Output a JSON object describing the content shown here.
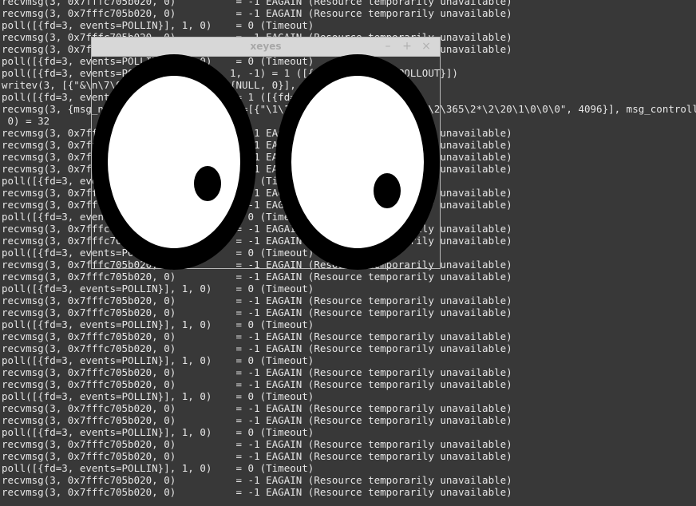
{
  "terminal": {
    "lines": [
      "recvmsg(3, 0x7fffc705b020, 0)          = -1 EAGAIN (Resource temporarily unavailable)",
      "recvmsg(3, 0x7fffc705b020, 0)          = -1 EAGAIN (Resource temporarily unavailable)",
      "poll([{fd=3, events=POLLIN}], 1, 0)    = 0 (Timeout)",
      "recvmsg(3, 0x7fffc705b020, 0)          = -1 EAGAIN (Resource temporarily unavailable)",
      "recvmsg(3, 0x7fffc705b020, 0)          = -1 EAGAIN (Resource temporarily unavailable)",
      "poll([{fd=3, events=POLLIN}], 1, 0)    = 0 (Timeout)",
      "poll([{fd=3, events=POLLIN|POLLOUT}], 1, -1) = 1 ([{fd=3, revents=POLLOUT}])",
      "writev(3, [{\"&\\n\\7\\0\", 4}, {NULL, 0}, {NULL, 0}], 3) = 4",
      "poll([{fd=3, events=POLLIN}], 1, -1)   = 1 ([{fd=3, revents=POLLIN}])",
      "recvmsg(3, {msg_name(0)=NULL, msg_iov(1)=[{\"\\1\\1\\0\\0\\0\\0\\0\\0\\0\\0h\\3\\341\\2\\365\\2*\\2\\20\\1\\0\\0\\0\", 4096}], msg_controllen=0, msg_flags=0}, 0) = 32",
      " 0) = 32",
      "recvmsg(3, 0x7fffc705b020, 0)          = -1 EAGAIN (Resource temporarily unavailable)",
      "recvmsg(3, 0x7fffc705b020, 0)          = -1 EAGAIN (Resource temporarily unavailable)",
      "recvmsg(3, 0x7fffc705b020, 0)          = -1 EAGAIN (Resource temporarily unavailable)",
      "recvmsg(3, 0x7fffc705b020, 0)          = -1 EAGAIN (Resource temporarily unavailable)",
      "poll([{fd=3, events=POLLIN}], 1, 0)    = 0 (Timeout)",
      "recvmsg(3, 0x7fffc705b020, 0)          = -1 EAGAIN (Resource temporarily unavailable)",
      "recvmsg(3, 0x7fffc705b020, 0)          = -1 EAGAIN (Resource temporarily unavailable)",
      "poll([{fd=3, events=POLLIN}], 1, 0)    = 0 (Timeout)",
      "recvmsg(3, 0x7fffc705b020, 0)          = -1 EAGAIN (Resource temporarily unavailable)",
      "recvmsg(3, 0x7fffc705b020, 0)          = -1 EAGAIN (Resource temporarily unavailable)",
      "poll([{fd=3, events=POLLIN}], 1, 0)    = 0 (Timeout)",
      "recvmsg(3, 0x7fffc705b020, 0)          = -1 EAGAIN (Resource temporarily unavailable)",
      "recvmsg(3, 0x7fffc705b020, 0)          = -1 EAGAIN (Resource temporarily unavailable)",
      "poll([{fd=3, events=POLLIN}], 1, 0)    = 0 (Timeout)",
      "recvmsg(3, 0x7fffc705b020, 0)          = -1 EAGAIN (Resource temporarily unavailable)",
      "recvmsg(3, 0x7fffc705b020, 0)          = -1 EAGAIN (Resource temporarily unavailable)",
      "poll([{fd=3, events=POLLIN}], 1, 0)    = 0 (Timeout)",
      "recvmsg(3, 0x7fffc705b020, 0)          = -1 EAGAIN (Resource temporarily unavailable)",
      "recvmsg(3, 0x7fffc705b020, 0)          = -1 EAGAIN (Resource temporarily unavailable)",
      "poll([{fd=3, events=POLLIN}], 1, 0)    = 0 (Timeout)",
      "recvmsg(3, 0x7fffc705b020, 0)          = -1 EAGAIN (Resource temporarily unavailable)",
      "recvmsg(3, 0x7fffc705b020, 0)          = -1 EAGAIN (Resource temporarily unavailable)",
      "poll([{fd=3, events=POLLIN}], 1, 0)    = 0 (Timeout)",
      "recvmsg(3, 0x7fffc705b020, 0)          = -1 EAGAIN (Resource temporarily unavailable)",
      "recvmsg(3, 0x7fffc705b020, 0)          = -1 EAGAIN (Resource temporarily unavailable)",
      "poll([{fd=3, events=POLLIN}], 1, 0)    = 0 (Timeout)",
      "recvmsg(3, 0x7fffc705b020, 0)          = -1 EAGAIN (Resource temporarily unavailable)",
      "recvmsg(3, 0x7fffc705b020, 0)          = -1 EAGAIN (Resource temporarily unavailable)",
      "poll([{fd=3, events=POLLIN}], 1, 0)    = 0 (Timeout)",
      "recvmsg(3, 0x7fffc705b020, 0)          = -1 EAGAIN (Resource temporarily unavailable)",
      "recvmsg(3, 0x7fffc705b020, 0)          = -1 EAGAIN (Resource temporarily unavailable)"
    ]
  },
  "window": {
    "title": "xeyes",
    "minimize_label": "–",
    "maximize_label": "+",
    "close_label": "×"
  },
  "colors": {
    "terminal_bg": "#383838",
    "terminal_fg": "#e6e6e6",
    "titlebar_bg": "#d7d7d7",
    "titlebar_fg": "#a8a8a8",
    "eye_outline": "#000000",
    "eye_white": "#ffffff",
    "pupil": "#000000"
  },
  "icons": {
    "minimize": "minimize-icon",
    "maximize": "maximize-icon",
    "close": "close-icon"
  }
}
